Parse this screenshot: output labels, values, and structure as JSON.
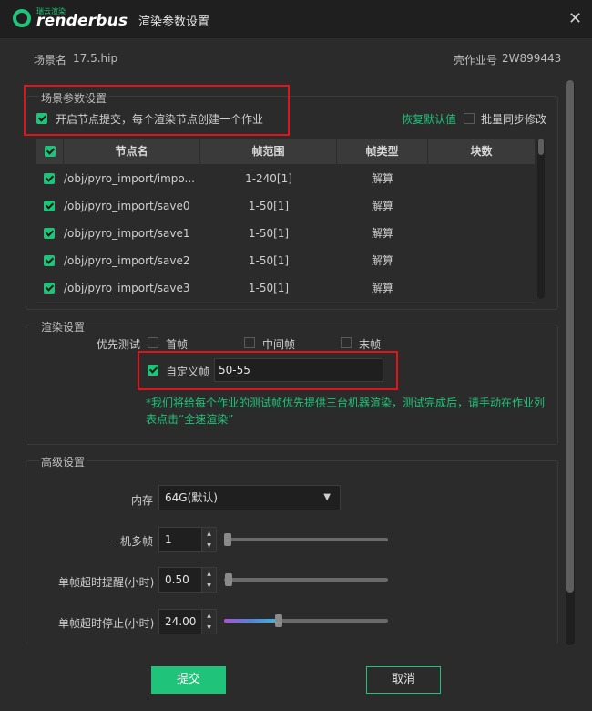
{
  "window": {
    "title": "渲染参数设置",
    "logo_small": "瑞云渲染",
    "logo_text": "renderbus",
    "close_icon": "✕"
  },
  "info": {
    "scene_label": "场景名",
    "scene_value": "17.5.hip",
    "job_label": "壳作业号",
    "job_value": "2W899443"
  },
  "scene_params": {
    "legend": "场景参数设置",
    "enable_node_submit": {
      "label": "开启节点提交，每个渲染节点创建一个作业",
      "checked": true
    },
    "restore_default": "恢复默认值",
    "batch_sync": {
      "label": "批量同步修改",
      "checked": false
    },
    "columns": [
      "节点名",
      "帧范围",
      "帧类型",
      "块数"
    ],
    "rows": [
      {
        "node": "/obj/pyro_import/impo...",
        "range": "1-240[1]",
        "type": "解算",
        "blocks": ""
      },
      {
        "node": "/obj/pyro_import/save0",
        "range": "1-50[1]",
        "type": "解算",
        "blocks": ""
      },
      {
        "node": "/obj/pyro_import/save1",
        "range": "1-50[1]",
        "type": "解算",
        "blocks": ""
      },
      {
        "node": "/obj/pyro_import/save2",
        "range": "1-50[1]",
        "type": "解算",
        "blocks": ""
      },
      {
        "node": "/obj/pyro_import/save3",
        "range": "1-50[1]",
        "type": "解算",
        "blocks": ""
      }
    ]
  },
  "render_settings": {
    "legend": "渲染设置",
    "priority_label": "优先测试",
    "first_frame": "首帧",
    "middle_frame": "中间帧",
    "last_frame": "末帧",
    "custom_frame": {
      "label": "自定义帧",
      "checked": true,
      "value": "50-55"
    },
    "notice": "*我们将给每个作业的测试帧优先提供三台机器渲染，测试完成后，请手动在作业列表点击“全速渲染”"
  },
  "advanced": {
    "legend": "高级设置",
    "memory_label": "内存",
    "memory_value": "64G(默认)",
    "multi_frame_label": "一机多帧",
    "multi_frame_value": "1",
    "timeout_warn_label": "单帧超时提醒(小时)",
    "timeout_warn_value": "0.50",
    "timeout_stop_label": "单帧超时停止(小时)",
    "timeout_stop_value": "24.00"
  },
  "footer": {
    "submit": "提交",
    "cancel": "取消"
  },
  "colors": {
    "accent": "#1fc47a",
    "highlight": "#e0141b",
    "background": "#2b2b2b"
  }
}
